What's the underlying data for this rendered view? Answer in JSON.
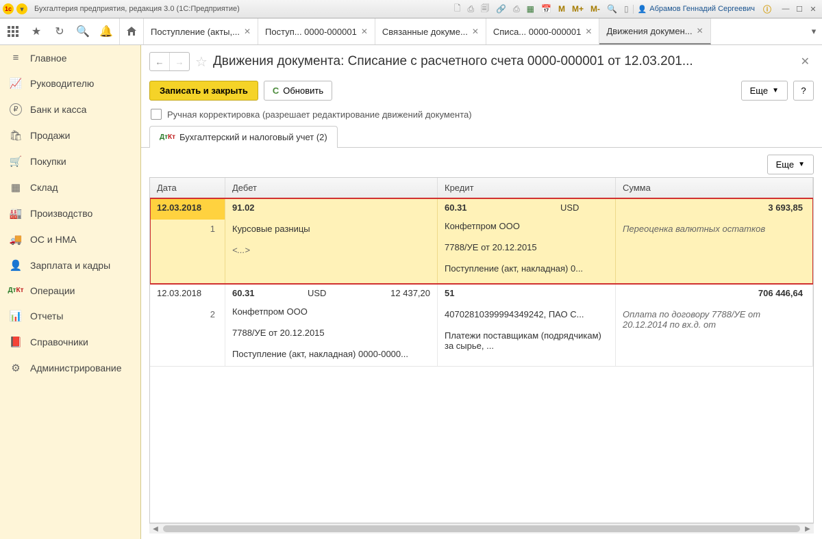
{
  "titlebar": {
    "app_title": "Бухгалтерия предприятия, редакция 3.0  (1С:Предприятие)",
    "m_btns": [
      "M",
      "M+",
      "M-"
    ],
    "user": "Абрамов Геннадий Сергеевич"
  },
  "tabs": [
    {
      "label": "Поступление (акты,..."
    },
    {
      "label": "Поступ... 0000-000001"
    },
    {
      "label": "Связанные докуме..."
    },
    {
      "label": "Списа... 0000-000001"
    },
    {
      "label": "Движения докумен..."
    }
  ],
  "sidebar": [
    {
      "icon": "≡",
      "label": "Главное"
    },
    {
      "icon": "chart",
      "label": "Руководителю"
    },
    {
      "icon": "₽",
      "label": "Банк и касса"
    },
    {
      "icon": "bag",
      "label": "Продажи"
    },
    {
      "icon": "cart",
      "label": "Покупки"
    },
    {
      "icon": "boxes",
      "label": "Склад"
    },
    {
      "icon": "factory",
      "label": "Производство"
    },
    {
      "icon": "truck",
      "label": "ОС и НМА"
    },
    {
      "icon": "person",
      "label": "Зарплата и кадры"
    },
    {
      "icon": "dtkt",
      "label": "Операции"
    },
    {
      "icon": "bars",
      "label": "Отчеты"
    },
    {
      "icon": "book",
      "label": "Справочники"
    },
    {
      "icon": "gear",
      "label": "Администрирование"
    }
  ],
  "page": {
    "title": "Движения документа: Списание с расчетного счета 0000-000001 от 12.03.201...",
    "save_close": "Записать и закрыть",
    "refresh": "Обновить",
    "more": "Еще",
    "help": "?",
    "manual_edit": "Ручная корректировка (разрешает редактирование движений документа)",
    "inner_tab": "Бухгалтерский и налоговый учет (2)"
  },
  "table": {
    "headers": {
      "date": "Дата",
      "debit": "Дебет",
      "credit": "Кредит",
      "sum": "Сумма"
    },
    "more": "Еще",
    "entries": [
      {
        "highlighted": true,
        "date": "12.03.2018",
        "num": "1",
        "debit_acc": "91.02",
        "debit_lines": [
          "Курсовые разницы",
          "<...>"
        ],
        "credit_acc": "60.31",
        "credit_cur": "USD",
        "credit_lines": [
          "Конфетпром ООО",
          "7788/УЕ от 20.12.2015",
          "Поступление (акт, накладная) 0..."
        ],
        "sum": "3 693,85",
        "sum_note": "Переоценка валютных остатков"
      },
      {
        "highlighted": false,
        "date": "12.03.2018",
        "num": "2",
        "debit_acc": "60.31",
        "debit_cur": "USD",
        "debit_amt": "12 437,20",
        "debit_lines": [
          "Конфетпром ООО",
          "7788/УЕ от 20.12.2015",
          "Поступление (акт, накладная) 0000-0000..."
        ],
        "credit_acc": "51",
        "credit_lines": [
          "40702810399994349242, ПАО С...",
          "Платежи поставщикам (подрядчикам) за сырье, ..."
        ],
        "sum": "706 446,64",
        "sum_note": "Оплата по договору 7788/УЕ от 20.12.2014 по вх.д.  от"
      }
    ]
  }
}
